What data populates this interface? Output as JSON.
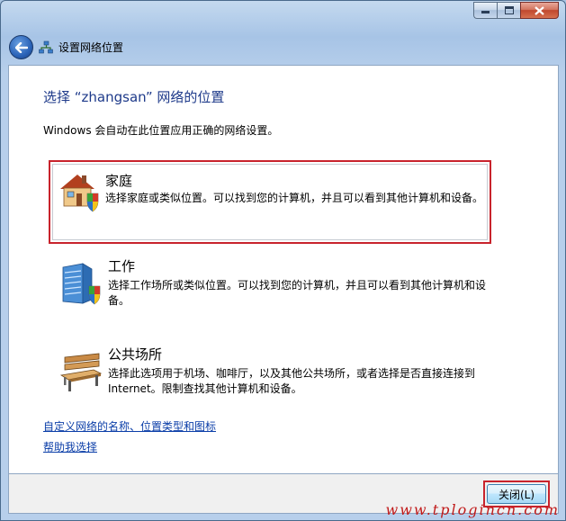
{
  "window": {
    "caption_buttons": [
      "minimize",
      "maximize",
      "close"
    ]
  },
  "nav": {
    "breadcrumb": "设置网络位置"
  },
  "main": {
    "title": "选择 “zhangsan” 网络的位置",
    "subtitle": "Windows 会自动在此位置应用正确的网络设置。",
    "options": [
      {
        "id": "home",
        "title": "家庭",
        "description": "选择家庭或类似位置。可以找到您的计算机，并且可以看到其他计算机和设备。",
        "icon": "house-shield-icon"
      },
      {
        "id": "work",
        "title": "工作",
        "description": "选择工作场所或类似位置。可以找到您的计算机，并且可以看到其他计算机和设备。",
        "icon": "office-building-shield-icon"
      },
      {
        "id": "public",
        "title": "公共场所",
        "description": "选择此选项用于机场、咖啡厅，以及其他公共场所，或者选择是否直接连接到 Internet。限制查找其他计算机和设备。",
        "icon": "park-bench-icon"
      }
    ],
    "links": {
      "customize": "自定义网络的名称、位置类型和图标",
      "help": "帮助我选择"
    }
  },
  "footer": {
    "close_label": "关闭(L)"
  },
  "watermark": "www.tplogincn.com",
  "colors": {
    "title_blue": "#1e3a8a",
    "link_blue": "#0b3ea8",
    "highlight_red": "#c8232c"
  }
}
